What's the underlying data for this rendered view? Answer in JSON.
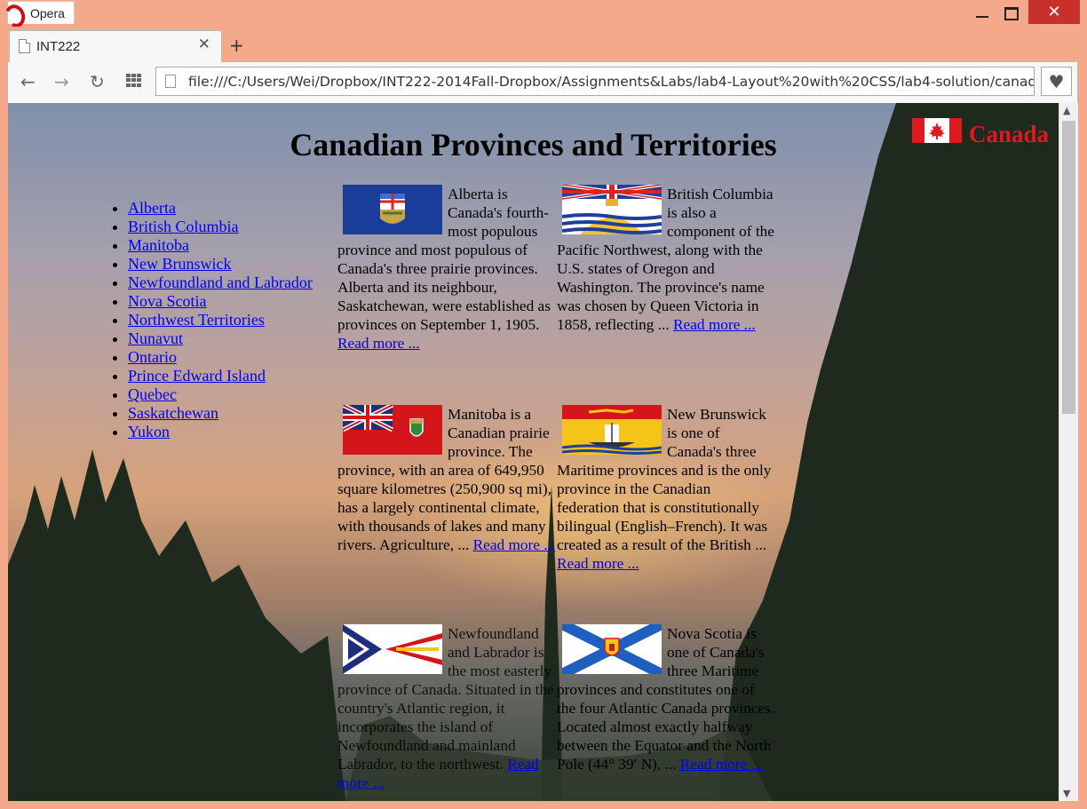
{
  "browser": {
    "app_name": "Opera",
    "tab_title": "INT222",
    "tab_close": "✕",
    "new_tab": "+",
    "url": "file:///C:/Users/Wei/Dropbox/INT222-2014Fall-Dropbox/Assignments&Labs/lab4-Layout%20with%20CSS/lab4-solution/canadianPT.htm",
    "nav_back_icon": "←",
    "nav_forward_icon": "→",
    "reload_icon": "↻",
    "heart_icon": "♥",
    "close_icon": "✕"
  },
  "page": {
    "title": "Canadian Provinces and Territories",
    "brand": "Canada",
    "colors": {
      "brand_red": "#e0191e",
      "link": "#0000ee"
    },
    "nav_links": [
      "Alberta",
      "British Columbia",
      "Manitoba",
      "New Brunswick",
      "Newfoundland and Labrador",
      "Nova Scotia",
      "Northwest Territories",
      "Nunavut",
      "Ontario",
      "Prince Edward Island",
      "Quebec",
      "Saskatchewan",
      "Yukon"
    ],
    "cards": [
      {
        "name": "alberta",
        "text": "Alberta is Canada's fourth-most populous province and most populous of Canada's three prairie provinces. Alberta and its neighbour, Saskatchewan, were established as provinces on September 1, 1905.",
        "more": "Read more ..."
      },
      {
        "name": "british-columbia",
        "text": "British Columbia is also a component of the Pacific Northwest, along with the U.S. states of Oregon and Washington. The province's name was chosen by Queen Victoria in 1858, reflecting ...",
        "more": "Read more ..."
      },
      {
        "name": "manitoba",
        "text": "Manitoba is a Canadian prairie province. The province, with an area of 649,950 square kilometres (250,900 sq mi), has a largely continental climate, with thousands of lakes and many rivers. Agriculture, ...",
        "more": "Read more ..."
      },
      {
        "name": "new-brunswick",
        "text": "New Brunswick is one of Canada's three Maritime provinces and is the only province in the Canadian federation that is constitutionally bilingual (English–French). It was created as a result of the British ...",
        "more": "Read more ..."
      },
      {
        "name": "newfoundland",
        "text": "Newfoundland and Labrador is the most easterly province of Canada. Situated in the country's Atlantic region, it incorporates the island of Newfoundland and mainland Labrador, to the northwest.",
        "more": "Read more ..."
      },
      {
        "name": "nova-scotia",
        "text": "Nova Scotia is one of Canada's three Maritime provinces and constitutes one of the four Atlantic Canada provinces. Located almost exactly halfway between the Equator and the North Pole (44° 39′ N), ...",
        "more": "Read more ..."
      }
    ]
  }
}
